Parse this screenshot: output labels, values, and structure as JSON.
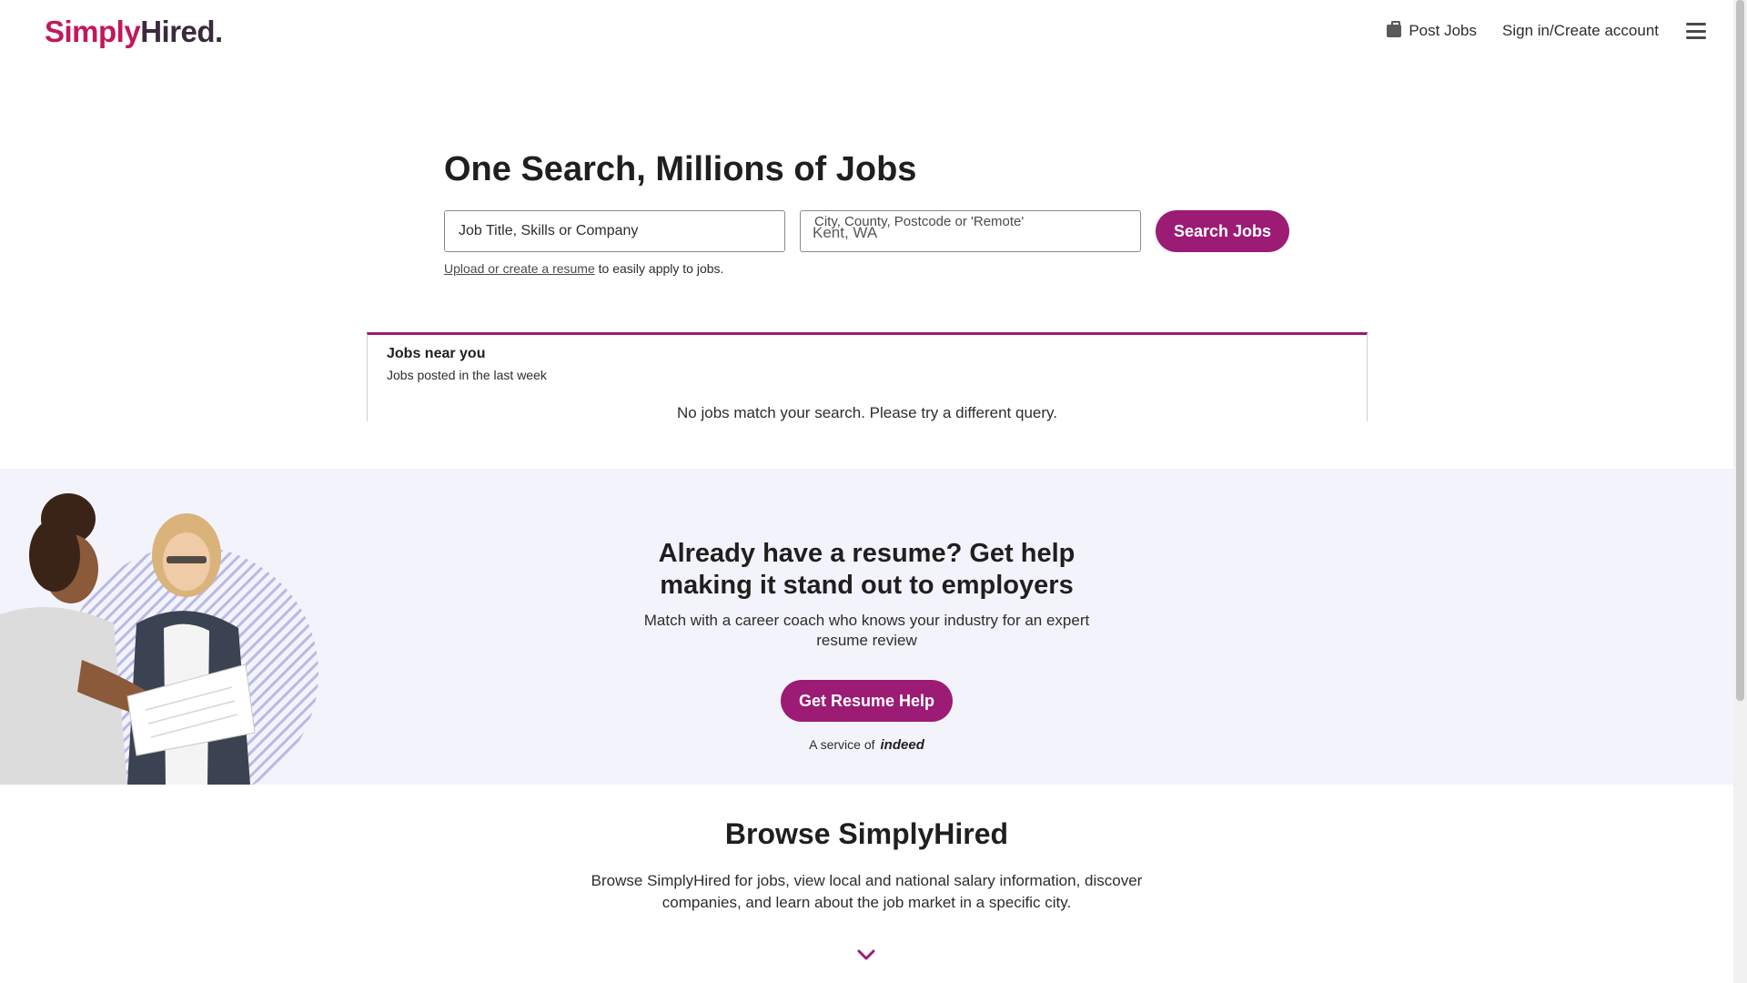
{
  "header": {
    "logo_simply": "Simply",
    "logo_hired": "Hired.",
    "post_jobs": "Post Jobs",
    "sign_in": "Sign in/Create account"
  },
  "search": {
    "title": "One Search, Millions of Jobs",
    "what_placeholder": "Job Title, Skills or Company",
    "where_label": "City, County, Postcode or 'Remote'",
    "where_value": "Kent, WA",
    "button": "Search Jobs",
    "resume_link": "Upload or create a resume",
    "resume_suffix": " to easily apply to jobs."
  },
  "jobs_near": {
    "title": "Jobs near you",
    "subtitle": "Jobs posted in the last week",
    "empty_message": "No jobs match your search. Please try a different query."
  },
  "resume_help": {
    "title_line1": "Already have a resume? Get help",
    "title_line2": "making it stand out to employers",
    "sub_line1": "Match with a career coach who knows your industry for an expert",
    "sub_line2": "resume review",
    "button": "Get Resume Help",
    "service_prefix": "A service of",
    "service_brand": "indeed"
  },
  "browse": {
    "title": "Browse SimplyHired",
    "text_line1": "Browse SimplyHired for jobs, view local and national salary information, discover",
    "text_line2": "companies, and learn about the job market in a specific city."
  },
  "colors": {
    "brand": "#9c1b74",
    "logo_accent": "#c2185b",
    "band_bg": "#f3f3fc"
  }
}
